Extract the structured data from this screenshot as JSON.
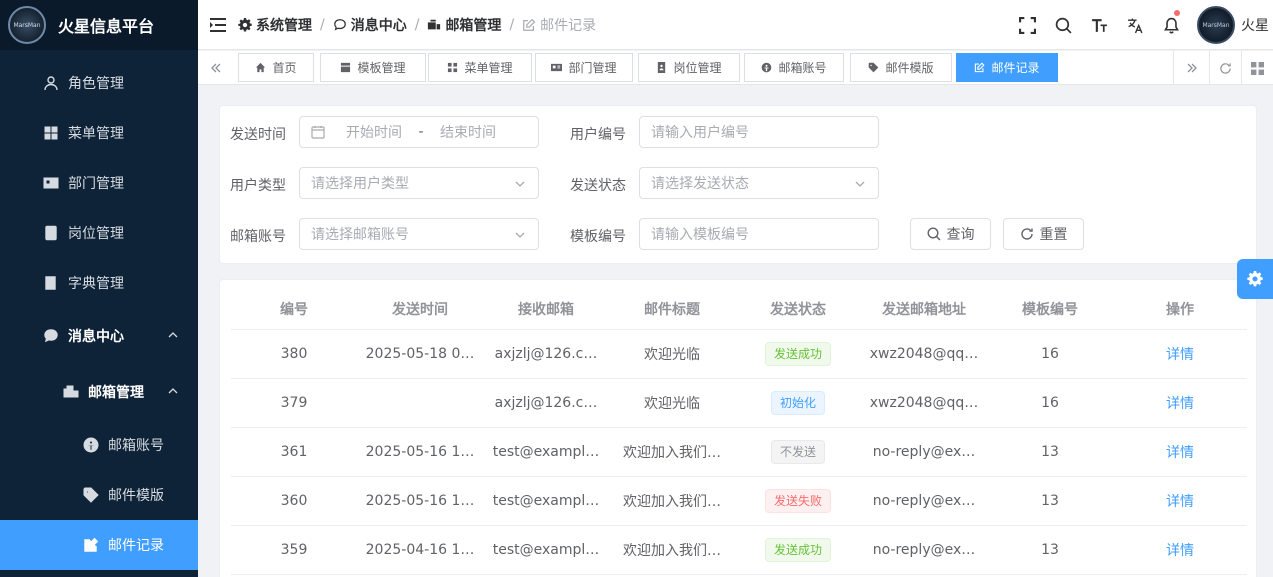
{
  "app": {
    "title": "火星信息平台",
    "logo_text": "MarsMan"
  },
  "sidebar": {
    "items": [
      {
        "label": "角色管理",
        "icon": "user-icon"
      },
      {
        "label": "菜单管理",
        "icon": "grid-icon"
      },
      {
        "label": "部门管理",
        "icon": "id-card-icon"
      },
      {
        "label": "岗位管理",
        "icon": "post-icon"
      },
      {
        "label": "字典管理",
        "icon": "book-icon"
      },
      {
        "label": "消息中心",
        "icon": "message-icon"
      },
      {
        "label": "邮箱管理",
        "icon": "mailbox-icon"
      },
      {
        "label": "邮箱账号",
        "icon": "account-icon"
      },
      {
        "label": "邮件模版",
        "icon": "tag-icon"
      },
      {
        "label": "邮件记录",
        "icon": "edit-icon"
      }
    ]
  },
  "header": {
    "breadcrumb": [
      "系统管理",
      "消息中心",
      "邮箱管理",
      "邮件记录"
    ],
    "user_name": "火星"
  },
  "tags": {
    "items": [
      {
        "label": "首页",
        "icon": "home-icon"
      },
      {
        "label": "模板管理",
        "icon": "template-icon"
      },
      {
        "label": "菜单管理",
        "icon": "grid-icon"
      },
      {
        "label": "部门管理",
        "icon": "id-card-icon"
      },
      {
        "label": "岗位管理",
        "icon": "post-icon"
      },
      {
        "label": "邮箱账号",
        "icon": "account-icon"
      },
      {
        "label": "邮件模版",
        "icon": "tag-icon"
      },
      {
        "label": "邮件记录",
        "icon": "edit-icon"
      }
    ]
  },
  "search": {
    "send_time_label": "发送时间",
    "start_placeholder": "开始时间",
    "range_sep": "-",
    "end_placeholder": "结束时间",
    "user_id_label": "用户编号",
    "user_id_placeholder": "请输入用户编号",
    "user_type_label": "用户类型",
    "user_type_placeholder": "请选择用户类型",
    "send_status_label": "发送状态",
    "send_status_placeholder": "请选择发送状态",
    "mail_account_label": "邮箱账号",
    "mail_account_placeholder": "请选择邮箱账号",
    "template_id_label": "模板编号",
    "template_id_placeholder": "请输入模板编号",
    "query_button": "查询",
    "reset_button": "重置"
  },
  "table": {
    "columns": [
      "编号",
      "发送时间",
      "接收邮箱",
      "邮件标题",
      "发送状态",
      "发送邮箱地址",
      "模板编号",
      "操作"
    ],
    "rows": [
      {
        "id": "380",
        "send_time": "2025-05-18 0…",
        "to": "axjzlj@126.c…",
        "title": "欢迎光临",
        "status": "发送成功",
        "from": "xwz2048@qq…",
        "template": "16",
        "action": "详情"
      },
      {
        "id": "379",
        "send_time": "",
        "to": "axjzlj@126.c…",
        "title": "欢迎光临",
        "status": "初始化",
        "from": "xwz2048@qq…",
        "template": "16",
        "action": "详情"
      },
      {
        "id": "361",
        "send_time": "2025-05-16 1…",
        "to": "test@exampl…",
        "title": "欢迎加入我们…",
        "status": "不发送",
        "from": "no-reply@ex…",
        "template": "13",
        "action": "详情"
      },
      {
        "id": "360",
        "send_time": "2025-05-16 1…",
        "to": "test@exampl…",
        "title": "欢迎加入我们…",
        "status": "发送失败",
        "from": "no-reply@ex…",
        "template": "13",
        "action": "详情"
      },
      {
        "id": "359",
        "send_time": "2025-04-16 1…",
        "to": "test@exampl…",
        "title": "欢迎加入我们…",
        "status": "发送成功",
        "from": "no-reply@ex…",
        "template": "13",
        "action": "详情"
      }
    ]
  },
  "status_colors": {
    "success": "#67c23a",
    "info": "#409eff",
    "neutral": "#909399",
    "danger": "#f56c6c"
  }
}
